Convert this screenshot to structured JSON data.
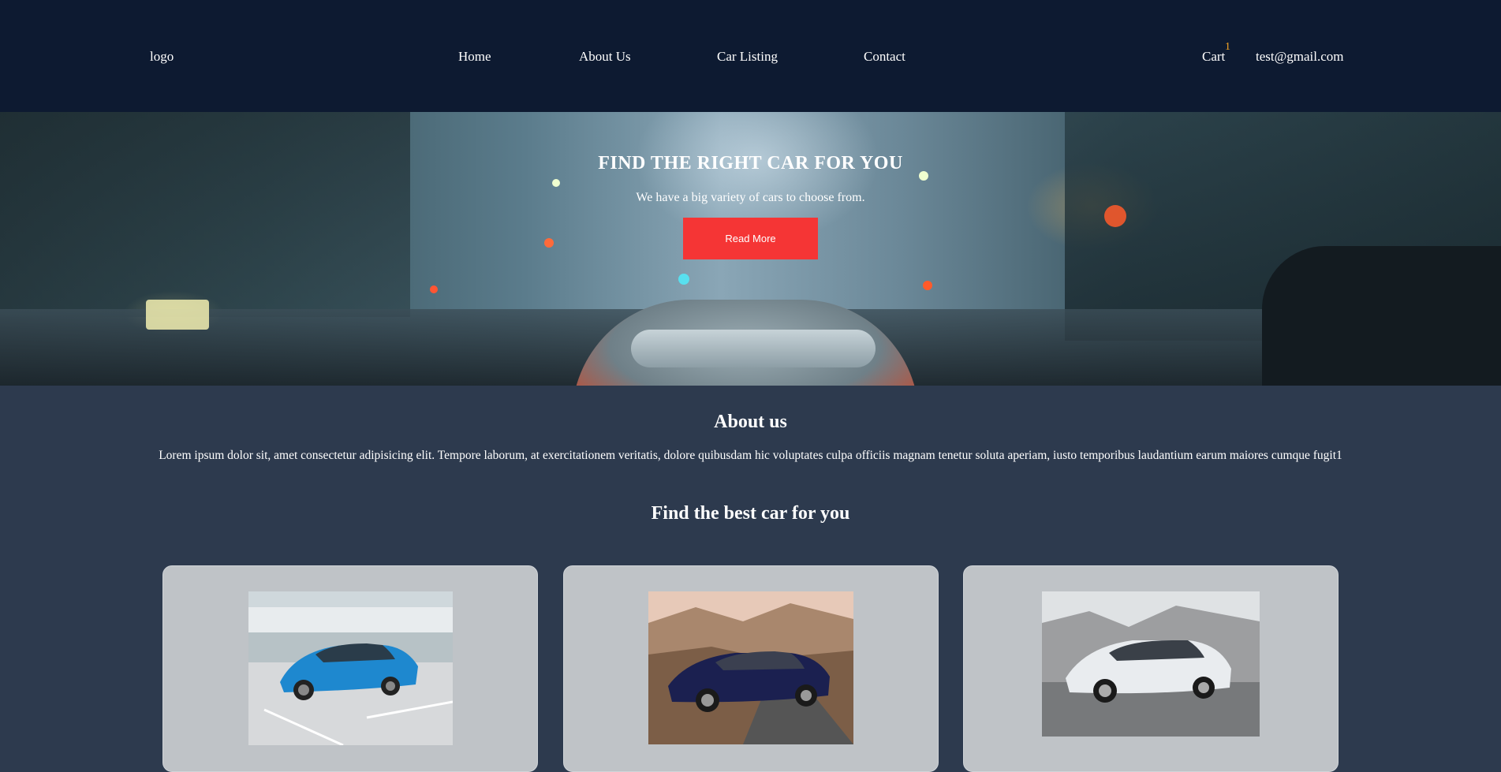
{
  "header": {
    "logo": "logo",
    "nav": [
      {
        "label": "Home"
      },
      {
        "label": "About Us"
      },
      {
        "label": "Car Listing"
      },
      {
        "label": "Contact"
      }
    ],
    "cart_label": "Cart",
    "cart_count": "1",
    "user_email": "test@gmail.com"
  },
  "hero": {
    "title": "FIND THE RIGHT CAR FOR YOU",
    "subtitle": "We have a big variety of cars to choose from.",
    "button_label": "Read More"
  },
  "about": {
    "title": "About us",
    "text": "Lorem ipsum dolor sit, amet consectetur adipisicing elit. Tempore laborum, at exercitationem veritatis, dolore quibusdam hic voluptates culpa officiis magnam tenetur soluta aperiam, iusto temporibus laudantium earum maiores cumque fugit1"
  },
  "cars_section": {
    "title": "Find the best car for you"
  },
  "colors": {
    "navbar": "#0d1a31",
    "page_bg": "#2d3a4e",
    "accent_button": "#f53535",
    "cart_badge": "#f5a524",
    "card_bg": "#bfc3c7"
  }
}
